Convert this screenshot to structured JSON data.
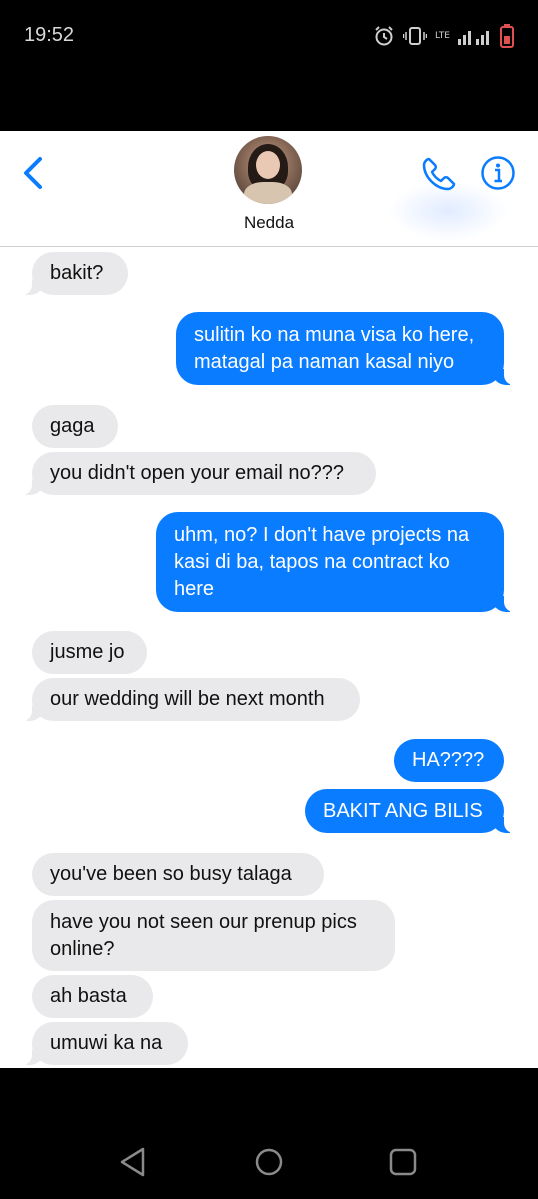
{
  "status_bar": {
    "time": "19:52",
    "icons": [
      "alarm-icon",
      "vibrate-icon",
      "lte-icon",
      "signal-icon",
      "battery-icon"
    ],
    "network": "LTE"
  },
  "header": {
    "contact_name": "Nedda",
    "accent_color": "#0a7cff",
    "icons": [
      "back-chevron-icon",
      "phone-icon",
      "info-icon"
    ]
  },
  "messages": [
    {
      "from": "them",
      "text": "bakit?"
    },
    {
      "from": "me",
      "text": "sulitin ko na muna visa ko here,\nmatagal pa naman kasal niyo"
    },
    {
      "from": "them",
      "text": "gaga"
    },
    {
      "from": "them",
      "text": "you didn't open your email no???"
    },
    {
      "from": "me",
      "text": "uhm, no? I don't have projects na\nkasi di ba, tapos na contract ko\nhere"
    },
    {
      "from": "them",
      "text": "jusme jo"
    },
    {
      "from": "them",
      "text": "our wedding will be next month"
    },
    {
      "from": "me",
      "text": "HA????"
    },
    {
      "from": "me",
      "text": "BAKIT ANG BILIS"
    },
    {
      "from": "them",
      "text": "you've been so busy talaga"
    },
    {
      "from": "them",
      "text": "have you not seen our prenup pics\nonline?"
    },
    {
      "from": "them",
      "text": "ah basta"
    },
    {
      "from": "them",
      "text": "umuwi ka na"
    }
  ],
  "nav_bar": {
    "icons": [
      "back-triangle-icon",
      "home-circle-icon",
      "recents-square-icon"
    ]
  }
}
